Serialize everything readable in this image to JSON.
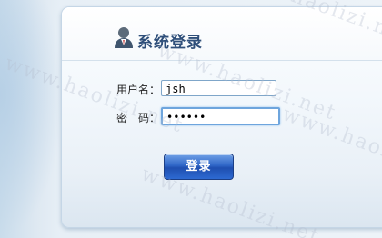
{
  "login": {
    "title": "系统登录",
    "username_label": "用户名：",
    "username_value": "jsh",
    "password_label": "密　码：",
    "password_value": "••••••",
    "submit_label": "登录"
  },
  "watermark": {
    "text": "www.haolizi.net"
  },
  "colors": {
    "title": "#2f4f7a",
    "button": "#2f66c7",
    "input_border": "#7fa6c9"
  },
  "icons": {
    "header": "user-icon"
  }
}
